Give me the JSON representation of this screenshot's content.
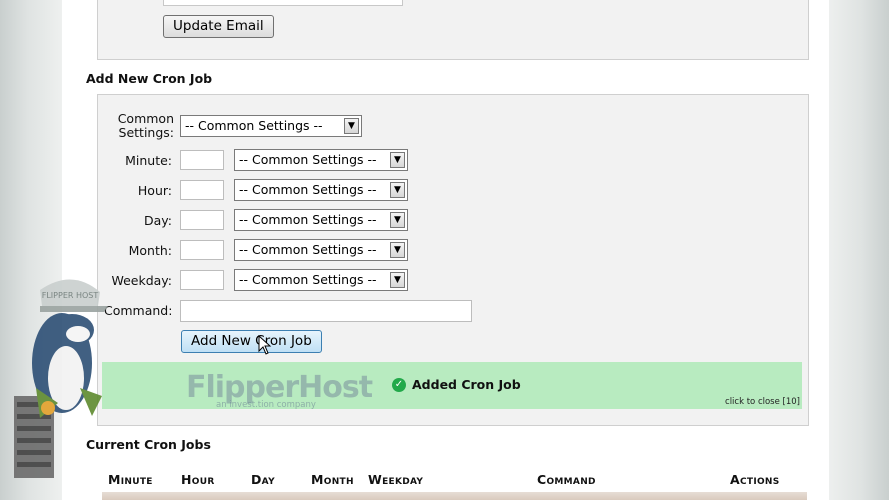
{
  "email_section": {
    "update_button": "Update Email"
  },
  "add_cron": {
    "title": "Add New Cron Job",
    "common_settings_label": "Common Settings:",
    "common_settings_value": "-- Common Settings --",
    "fields": [
      {
        "label": "Minute:",
        "select": "-- Common Settings --"
      },
      {
        "label": "Hour:",
        "select": "-- Common Settings --"
      },
      {
        "label": "Day:",
        "select": "-- Common Settings --"
      },
      {
        "label": "Month:",
        "select": "-- Common Settings --"
      },
      {
        "label": "Weekday:",
        "select": "-- Common Settings --"
      }
    ],
    "command_label": "Command:",
    "add_button": "Add New Cron Job"
  },
  "notification": {
    "message": "Added Cron Job",
    "close_text": "click to close [10]",
    "logo_name": "FlipperHost",
    "logo_tagline": "an invest.tion company",
    "color": "#b8ebc0"
  },
  "current_cron": {
    "title": "Current Cron Jobs",
    "columns": [
      "Minute",
      "Hour",
      "Day",
      "Month",
      "Weekday",
      "Command",
      "Actions"
    ]
  },
  "mascot": {
    "cap_text": "FLIPPER HOST"
  },
  "colors": {
    "panel_bg": "#f2f2f2",
    "button_accent": "#bfe0f5",
    "success_green": "#22a94a"
  }
}
